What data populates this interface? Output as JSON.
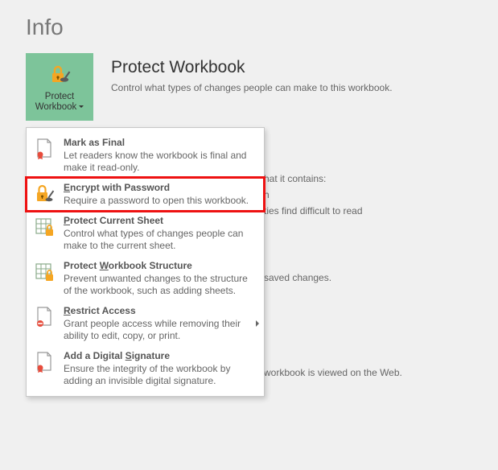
{
  "page": {
    "title": "Info"
  },
  "protectButton": {
    "line1": "Protect",
    "line2": "Workbook"
  },
  "section": {
    "title": "Protect Workbook",
    "desc": "Control what types of changes people can make to this workbook."
  },
  "bgText": {
    "l1": "hat it contains:",
    "l2": "h",
    "l3": "ties find difficult to read",
    "l4": "saved changes.",
    "l5": "workbook is viewed on the Web."
  },
  "menu": {
    "markFinal": {
      "title_pre": "",
      "title_u": "",
      "title_post": "Mark as Final",
      "desc": "Let readers know the workbook is final and make it read-only."
    },
    "encrypt": {
      "title_pre": "",
      "title_u": "E",
      "title_post": "ncrypt with Password",
      "desc": "Require a password to open this workbook."
    },
    "protectSheet": {
      "title_pre": "",
      "title_u": "P",
      "title_post": "rotect Current Sheet",
      "desc": "Control what types of changes people can make to the current sheet."
    },
    "protectStructure": {
      "title_pre": "Protect ",
      "title_u": "W",
      "title_post": "orkbook Structure",
      "desc": "Prevent unwanted changes to the structure of the workbook, such as adding sheets."
    },
    "restrict": {
      "title_pre": "",
      "title_u": "R",
      "title_post": "estrict Access",
      "desc": "Grant people access while removing their ability to edit, copy, or print."
    },
    "signature": {
      "title_pre": "Add a Digital ",
      "title_u": "S",
      "title_post": "ignature",
      "desc": "Ensure the integrity of the workbook by adding an invisible digital signature."
    }
  }
}
